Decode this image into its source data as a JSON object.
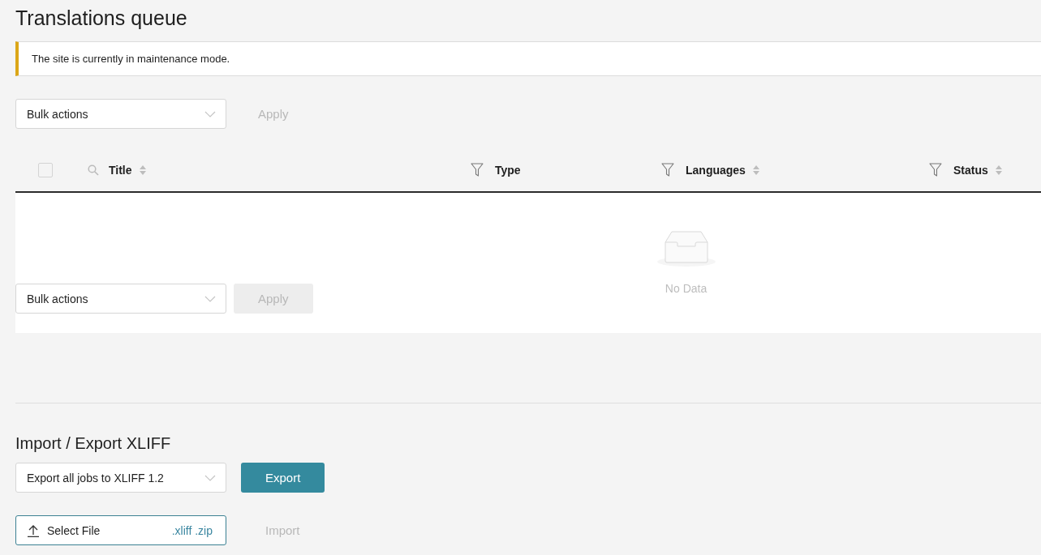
{
  "page_title": "Translations queue",
  "notice": {
    "text": "The site is currently in maintenance mode."
  },
  "top_actions": {
    "select": {
      "value": "Bulk actions"
    },
    "apply": {
      "label": "Apply",
      "disabled": true
    }
  },
  "table": {
    "select_all": {
      "checked": false
    },
    "columns": [
      {
        "label": "Title",
        "kind": "search",
        "sortable": true
      },
      {
        "label": "Type",
        "kind": "filter",
        "sortable": false
      },
      {
        "label": "Languages",
        "kind": "filter",
        "sortable": true
      },
      {
        "label": "Status",
        "kind": "filter",
        "sortable": true
      }
    ],
    "empty_text": "No Data"
  },
  "bottom_actions": {
    "select": {
      "value": "Bulk actions"
    },
    "apply": {
      "label": "Apply",
      "disabled": true
    }
  },
  "import_export": {
    "heading": "Import / Export XLIFF",
    "export_select": {
      "value": "Export all jobs to XLIFF 1.2"
    },
    "export_button": {
      "label": "Export",
      "disabled": false
    },
    "file_picker": {
      "label": "Select File",
      "accepted": ".xliff .zip"
    },
    "import_button": {
      "label": "Import",
      "disabled": true
    }
  }
}
